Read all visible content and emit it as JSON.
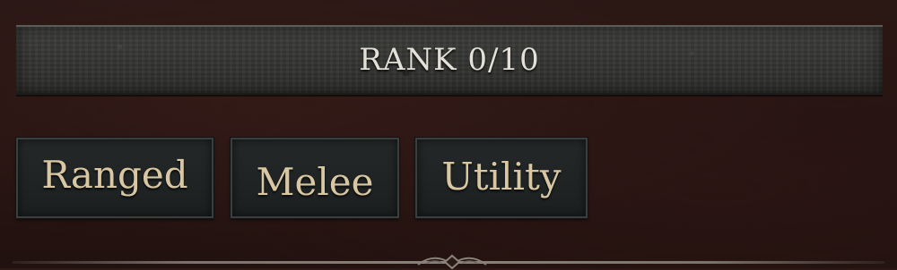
{
  "rank": {
    "label": "RANK 0/10",
    "current": 0,
    "max": 10
  },
  "tabs": [
    {
      "label": "Ranged"
    },
    {
      "label": "Melee"
    },
    {
      "label": "Utility"
    }
  ],
  "colors": {
    "background": "#261412",
    "banner": "#363734",
    "tab_background": "#1f2323",
    "tab_text": "#d8c7a2",
    "rank_text": "#e3e0d8"
  },
  "icons": {
    "divider_ornament": "ornament-icon"
  }
}
